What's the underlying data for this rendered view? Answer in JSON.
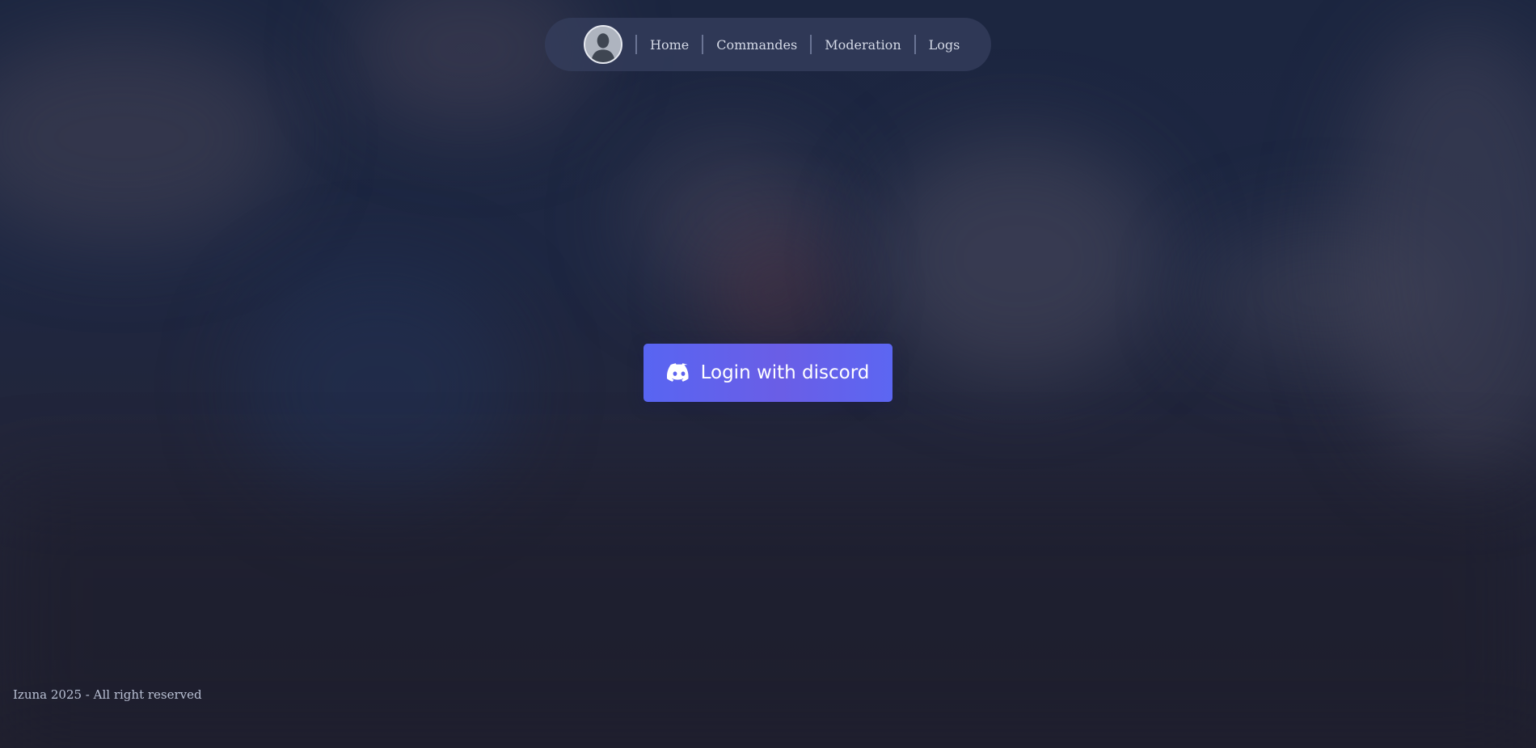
{
  "nav": {
    "avatar_icon": "user-avatar-icon",
    "links": [
      {
        "label": "Home"
      },
      {
        "label": "Commandes"
      },
      {
        "label": "Moderation"
      },
      {
        "label": "Logs"
      }
    ]
  },
  "login": {
    "label": "Login with discord",
    "icon": "discord-icon",
    "color": "#5865f2"
  },
  "footer": {
    "text": "Izuna 2025 - All right reserved"
  }
}
